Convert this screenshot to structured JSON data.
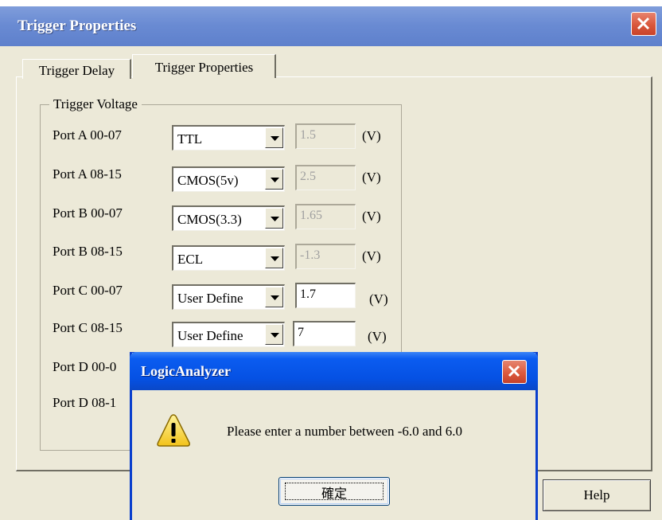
{
  "window": {
    "title": "Trigger Properties"
  },
  "tabs": [
    {
      "label": "Trigger Delay",
      "selected": false
    },
    {
      "label": "Trigger Properties",
      "selected": true
    }
  ],
  "group": {
    "label": "Trigger Voltage"
  },
  "ports": [
    {
      "label": "Port A 00-07",
      "type": "TTL",
      "voltage": "1.5",
      "unit": "(V)",
      "editable": false
    },
    {
      "label": "Port A 08-15",
      "type": "CMOS(5v)",
      "voltage": "2.5",
      "unit": "(V)",
      "editable": false
    },
    {
      "label": "Port B 00-07",
      "type": "CMOS(3.3)",
      "voltage": "1.65",
      "unit": "(V)",
      "editable": false
    },
    {
      "label": "Port B 08-15",
      "type": "ECL",
      "voltage": "-1.3",
      "unit": "(V)",
      "editable": false
    },
    {
      "label": "Port C 00-07",
      "type": "User Define",
      "voltage": "1.7",
      "unit": "(V)",
      "editable": true
    },
    {
      "label": "Port C 08-15",
      "type": "User Define",
      "voltage": "7",
      "unit": "(V)",
      "editable": true
    },
    {
      "label": "Port D 00-0"
    },
    {
      "label": "Port D 08-1"
    }
  ],
  "buttons": {
    "help": "Help"
  },
  "dialog": {
    "title": "LogicAnalyzer",
    "message": "Please enter a number between -6.0 and 6.0",
    "ok": "確定",
    "icon": "warning-icon"
  },
  "colors": {
    "main_titlebar": "#6a8bd3",
    "dialog_titlebar": "#0551e3",
    "close_button": "#d9573c",
    "face": "#ece9d8"
  }
}
